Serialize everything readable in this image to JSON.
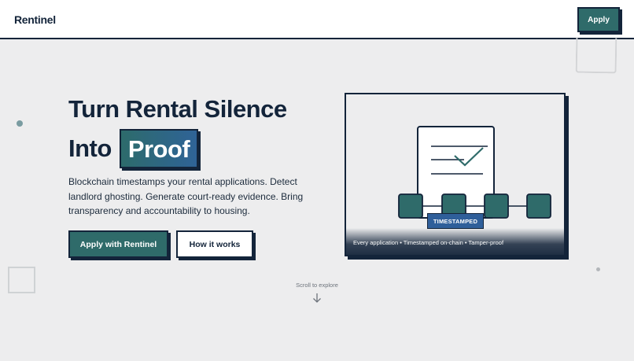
{
  "header": {
    "logo": "Rentinel",
    "apply_label": "Apply"
  },
  "hero": {
    "title_line1": "Turn Rental Silence",
    "title_line2_prefix": "Into",
    "title_highlight": "Proof",
    "description": "Blockchain timestamps your rental applications. Detect landlord ghosting. Generate court-ready evidence. Bring transparency and accountability to housing.",
    "primary_button": "Apply with Rentinel",
    "secondary_button": "How it works"
  },
  "illustration": {
    "badge": "TIMESTAMPED",
    "caption": "Every application • Timestamped on-chain • Tamper-proof"
  },
  "scroll": {
    "label": "Scroll to explore",
    "icon": "arrow-down-icon"
  },
  "colors": {
    "navy": "#13243a",
    "teal": "#2f6b6a",
    "blue": "#2f5f9a",
    "background": "#ededee"
  }
}
